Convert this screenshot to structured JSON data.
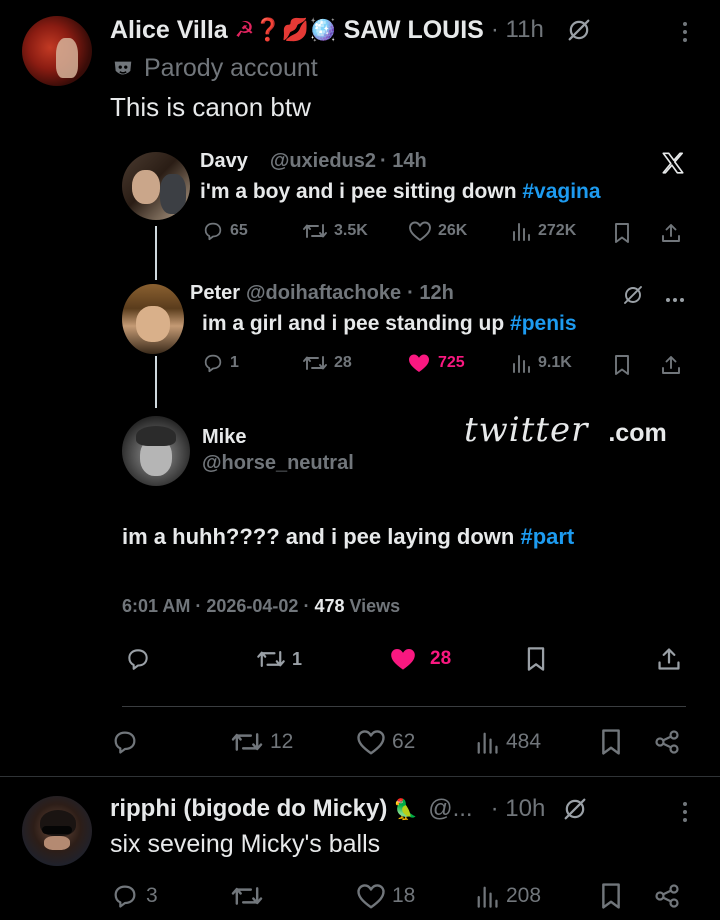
{
  "post1": {
    "author_name": "Alice Villa",
    "author_emojis": "☭❓💋🪩",
    "author_suffix": "SAW LOUIS",
    "time": "· 11h",
    "badge_text": "Parody account",
    "text": "This is canon btw",
    "stats": {
      "replies": "",
      "retweets": "12",
      "likes": "62",
      "views": "484"
    }
  },
  "embed": {
    "watermark_script": "twitter",
    "watermark_com": ".com",
    "davy": {
      "name": "Davy",
      "handle": "@uxiedus2",
      "time": "· 14h",
      "text_plain": "i'm a boy and i pee sitting down ",
      "hashtag": "#vagina",
      "stats": {
        "replies": "65",
        "retweets": "3.5K",
        "likes": "26K",
        "views": "272K"
      }
    },
    "peter": {
      "name": "Peter",
      "handle": "@doihaftachoke",
      "time": "· 12h",
      "text_plain": "im a girl and i pee standing up ",
      "hashtag": "#penis",
      "stats": {
        "replies": "1",
        "retweets": "28",
        "likes": "725",
        "views": "9.1K"
      }
    },
    "mike": {
      "name": "Mike",
      "handle": "@horse_neutral",
      "text_plain": "im a huhh???? and i pee laying down ",
      "hashtag": "#part",
      "time": "6:01 AM",
      "date": "2026-04-02",
      "views_count": "478",
      "views_label": "Views",
      "stats": {
        "retweets": "1",
        "likes": "28"
      }
    }
  },
  "post2": {
    "author_name": "ripphi (bigode do Micky)",
    "author_emoji": "🦜",
    "handle": "@...",
    "time": "· 10h",
    "text": "six seveing Micky's balls",
    "stats": {
      "replies": "3",
      "retweets": "",
      "likes": "18",
      "views": "208"
    }
  },
  "colors": {
    "accent": "#1d9bf0",
    "like": "#f91880",
    "muted": "#71767b"
  }
}
